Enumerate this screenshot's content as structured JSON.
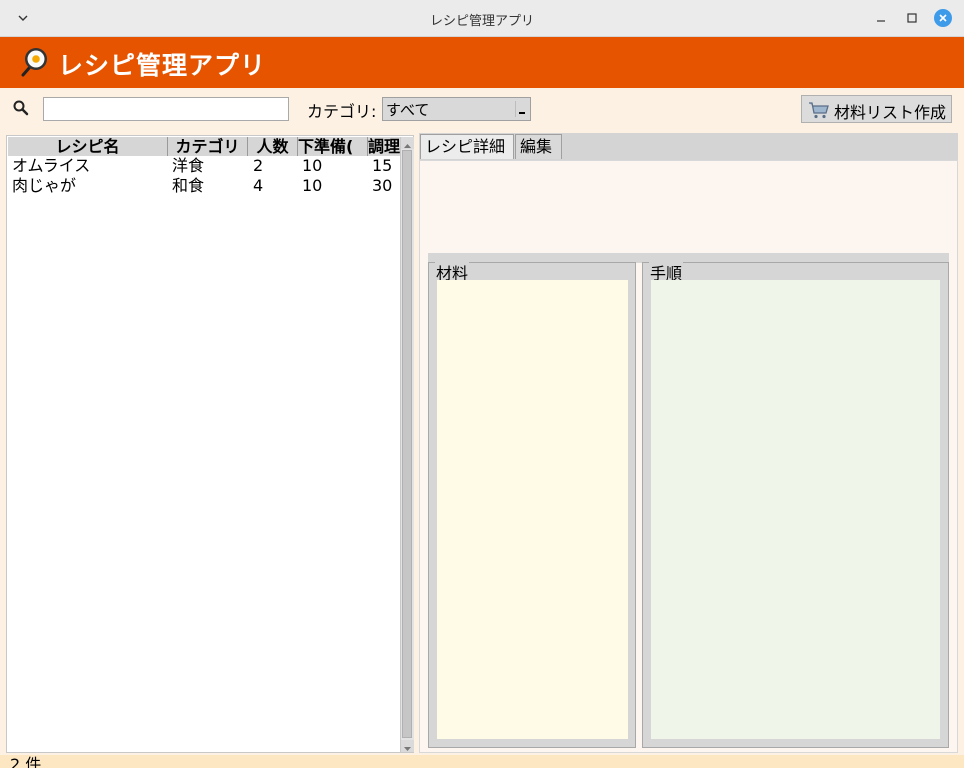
{
  "window": {
    "title": "レシピ管理アプリ"
  },
  "header": {
    "title": "レシピ管理アプリ",
    "logo_icon": "frying-pan-egg-icon",
    "bg_color": "#e65400"
  },
  "toolbar": {
    "search_value": "",
    "category_label": "カテゴリ:",
    "category_selected": "すべて",
    "list_button_label": "材料リスト作成",
    "list_button_icon": "shopping-cart-icon"
  },
  "table": {
    "columns": [
      "レシピ名",
      "カテゴリ",
      "人数",
      "下準備(分)",
      "調理"
    ],
    "column_display": [
      "レシピ名",
      "カテゴリ",
      "人数",
      "下準備(",
      "調理"
    ],
    "rows": [
      [
        "オムライス",
        "洋食",
        "2",
        "10",
        "15"
      ],
      [
        "肉じゃが",
        "和食",
        "4",
        "10",
        "30"
      ]
    ]
  },
  "tabs": [
    "レシピ詳細",
    "編集"
  ],
  "detail": {
    "ingredients_label": "材料",
    "steps_label": "手順"
  },
  "status": {
    "text": "2 件"
  }
}
